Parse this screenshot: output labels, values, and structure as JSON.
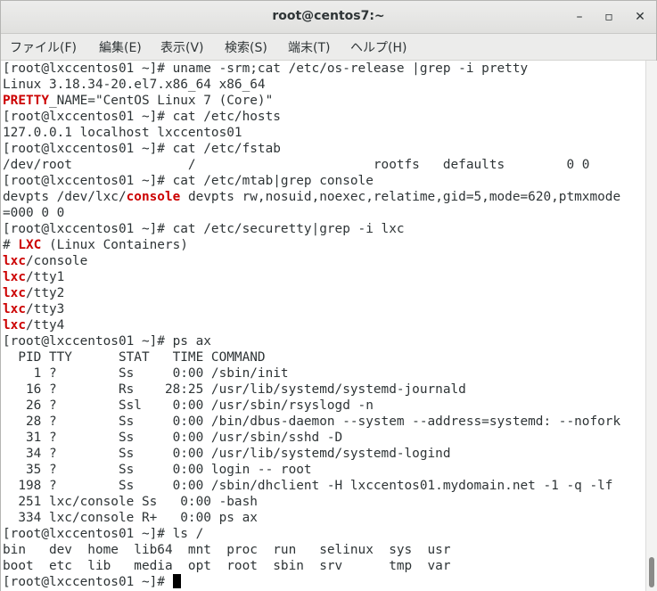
{
  "window": {
    "title": "root@centos7:~"
  },
  "controls": {
    "minimize": "–",
    "maximize": "▫",
    "close": "✕"
  },
  "menu": [
    "ファイル(F)",
    "編集(E)",
    "表示(V)",
    "検索(S)",
    "端末(T)",
    "ヘルプ(H)"
  ],
  "terminal": {
    "lines": [
      "[root@lxccentos01 ~]# uname -srm;cat /etc/os-release |grep -i pretty",
      "Linux 3.18.34-20.el7.x86_64 x86_64",
      "PRETTY_NAME=\"CentOS Linux 7 (Core)\"",
      "[root@lxccentos01 ~]# cat /etc/hosts",
      "127.0.0.1 localhost lxccentos01",
      "[root@lxccentos01 ~]# cat /etc/fstab",
      "/dev/root               /                       rootfs   defaults        0 0",
      "[root@lxccentos01 ~]# cat /etc/mtab|grep console",
      "devpts /dev/lxc/console devpts rw,nosuid,noexec,relatime,gid=5,mode=620,ptmxmode",
      "=000 0 0",
      "[root@lxccentos01 ~]# cat /etc/securetty|grep -i lxc",
      "# LXC (Linux Containers)",
      "lxc/console",
      "lxc/tty1",
      "lxc/tty2",
      "lxc/tty3",
      "lxc/tty4",
      "[root@lxccentos01 ~]# ps ax",
      "  PID TTY      STAT   TIME COMMAND",
      "    1 ?        Ss     0:00 /sbin/init",
      "   16 ?        Rs    28:25 /usr/lib/systemd/systemd-journald",
      "   26 ?        Ssl    0:00 /usr/sbin/rsyslogd -n",
      "   28 ?        Ss     0:00 /bin/dbus-daemon --system --address=systemd: --nofork",
      "   31 ?        Ss     0:00 /usr/sbin/sshd -D",
      "   34 ?        Ss     0:00 /usr/lib/systemd/systemd-logind",
      "   35 ?        Ss     0:00 login -- root",
      "  198 ?        Ss     0:00 /sbin/dhclient -H lxccentos01.mydomain.net -1 -q -lf",
      "  251 lxc/console Ss   0:00 -bash",
      "  334 lxc/console R+   0:00 ps ax",
      "[root@lxccentos01 ~]# ls /",
      "bin   dev  home  lib64  mnt  proc  run   selinux  sys  usr",
      "boot  etc  lib   media  opt  root  sbin  srv      tmp  var",
      "[root@lxccentos01 ~]# "
    ],
    "highlights": {
      "2": [
        "PRETTY"
      ],
      "8": [
        "console"
      ],
      "11": [
        "LXC"
      ],
      "12": [
        "lxc"
      ],
      "13": [
        "lxc"
      ],
      "14": [
        "lxc"
      ],
      "15": [
        "lxc"
      ],
      "16": [
        "lxc"
      ]
    },
    "highlight_color": "#cc0000",
    "text_color": "#2e3436"
  }
}
